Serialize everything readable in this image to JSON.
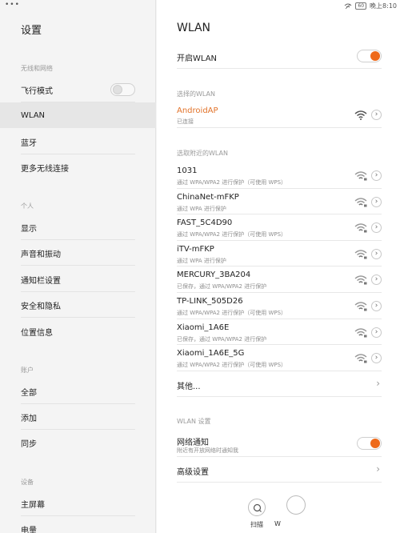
{
  "status": {
    "dots": "•••",
    "time": "晚上8:10",
    "battery": "60"
  },
  "sidebar": {
    "title": "设置",
    "sections": {
      "wireless": "无线和网络",
      "personal": "个人",
      "account": "账户",
      "device": "设备"
    },
    "items": [
      {
        "label": "飞行模式"
      },
      {
        "label": "WLAN"
      },
      {
        "label": "蓝牙"
      },
      {
        "label": "更多无线连接"
      },
      {
        "label": "显示"
      },
      {
        "label": "声音和振动"
      },
      {
        "label": "通知栏设置"
      },
      {
        "label": "安全和隐私"
      },
      {
        "label": "位置信息"
      },
      {
        "label": "全部"
      },
      {
        "label": "添加"
      },
      {
        "label": "同步"
      },
      {
        "label": "主屏幕"
      },
      {
        "label": "电量"
      }
    ]
  },
  "main": {
    "title": "WLAN",
    "enable_label": "开启WLAN",
    "connected_section": "选择的WLAN",
    "connected": {
      "name": "AndroidAP",
      "status": "已连接"
    },
    "nearby_section": "选取附近的WLAN",
    "networks": [
      {
        "name": "1031",
        "desc": "通过 WPA/WPA2 进行保护（可使用 WPS）"
      },
      {
        "name": "ChinaNet-mFKP",
        "desc": "通过 WPA 进行保护"
      },
      {
        "name": "FAST_5C4D90",
        "desc": "通过 WPA/WPA2 进行保护（可使用 WPS）"
      },
      {
        "name": "iTV-mFKP",
        "desc": "通过 WPA 进行保护"
      },
      {
        "name": "MERCURY_3BA204",
        "desc": "已保存，通过 WPA/WPA2 进行保护"
      },
      {
        "name": "TP-LINK_505D26",
        "desc": "通过 WPA/WPA2 进行保护（可使用 WPS）"
      },
      {
        "name": "Xiaomi_1A6E",
        "desc": "已保存，通过 WPA/WPA2 进行保护"
      },
      {
        "name": "Xiaomi_1A6E_5G",
        "desc": "通过 WPA/WPA2 进行保护（可使用 WPS）"
      }
    ],
    "other_label": "其他...",
    "settings_section": "WLAN 设置",
    "notify": {
      "label": "网络通知",
      "desc": "附近有开放网络时通知我"
    },
    "advanced_label": "高级设置",
    "scan_label": "扫描",
    "wps_label": "W"
  },
  "colors": {
    "accent": "#ee6a1b",
    "connected": "#e2732a"
  }
}
